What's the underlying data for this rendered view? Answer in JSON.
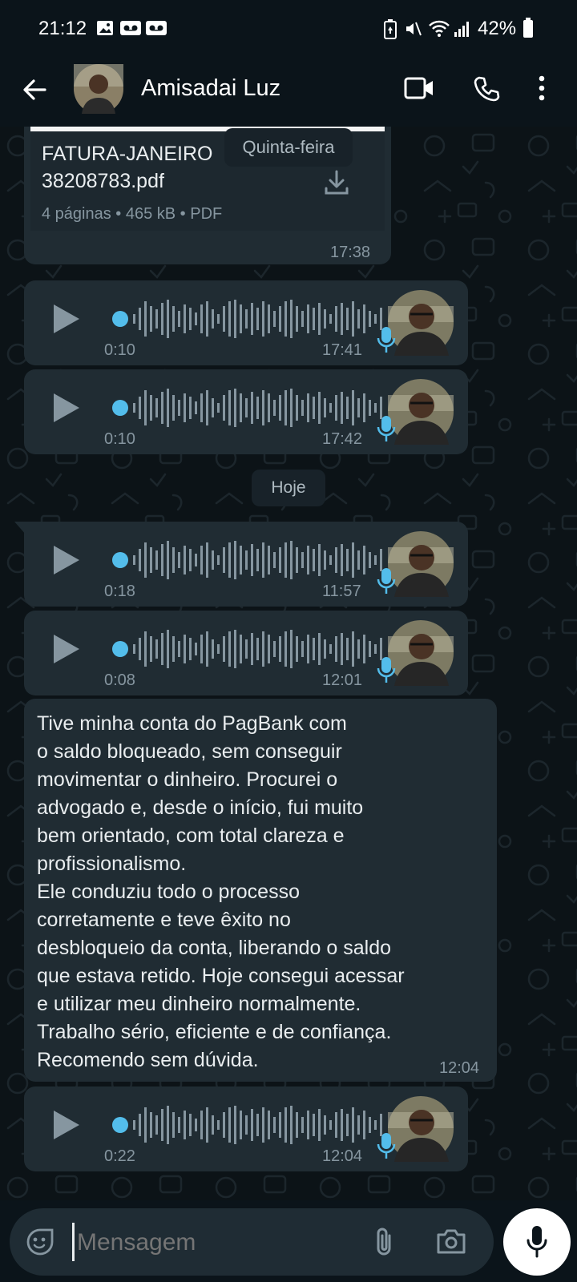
{
  "status_bar": {
    "time": "21:12",
    "battery": "42%"
  },
  "header": {
    "contact_name": "Amisadai Luz"
  },
  "document": {
    "filename_line1": "FATURA-JANEIRO",
    "filename_line2": "38208783.pdf",
    "meta": "4 páginas • 465 kB • PDF",
    "time": "17:38"
  },
  "date_tooltip": "Quinta-feira",
  "date_separator": "Hoje",
  "voice_messages": [
    {
      "duration": "0:10",
      "time": "17:41"
    },
    {
      "duration": "0:10",
      "time": "17:42"
    },
    {
      "duration": "0:18",
      "time": "11:57"
    },
    {
      "duration": "0:08",
      "time": "12:01"
    },
    {
      "duration": "0:22",
      "time": "12:04"
    }
  ],
  "text_message": {
    "lines": [
      "Tive minha conta do PagBank com",
      "o saldo bloqueado, sem conseguir",
      "movimentar o dinheiro. Procurei o",
      "advogado e, desde o início, fui muito",
      "bem orientado, com total clareza e",
      "profissionalismo.",
      "Ele conduziu todo o processo",
      "corretamente e teve êxito no",
      "desbloqueio da conta, liberando o saldo",
      "que estava retido. Hoje consegui acessar",
      "e utilizar meu dinheiro normalmente.",
      "Trabalho sério, eficiente e de confiança.",
      "Recomendo sem dúvida."
    ],
    "time": "12:04"
  },
  "composer": {
    "placeholder": "Mensagem"
  },
  "colors": {
    "accent_blue": "#53bdeb",
    "bubble": "#202c33",
    "background": "#0b141a"
  }
}
